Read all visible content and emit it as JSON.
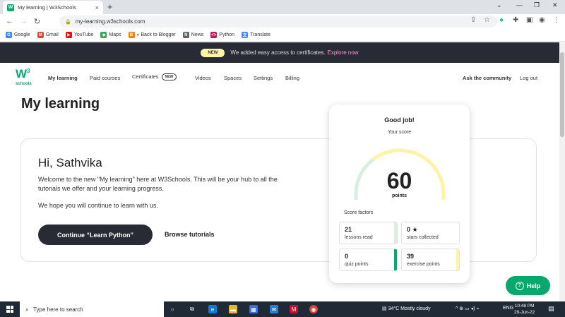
{
  "browser": {
    "tab_title": "My learning | W3Schools",
    "tab_favicon": "w3-favicon",
    "tab_close": "×",
    "new_tab": "+",
    "url": "my-learning.w3schools.com",
    "bookmarks": [
      {
        "label": "Google",
        "icon": "google-icon",
        "color": "#4285f4",
        "glyph": "G"
      },
      {
        "label": "Gmail",
        "icon": "gmail-icon",
        "color": "#ea4335",
        "glyph": "M"
      },
      {
        "label": "YouTube",
        "icon": "youtube-icon",
        "color": "#ff0000",
        "glyph": "▶"
      },
      {
        "label": "Maps",
        "icon": "maps-icon",
        "color": "#34a853",
        "glyph": "◆"
      },
      {
        "label": "« Back to Blogger",
        "icon": "blogger-icon",
        "color": "#f57d00",
        "glyph": "B"
      },
      {
        "label": "News",
        "icon": "news-icon",
        "color": "#5f6368",
        "glyph": "N"
      },
      {
        "label": "Python",
        "icon": "python-icon",
        "color": "#c2185b",
        "glyph": "<>"
      },
      {
        "label": "Translate",
        "icon": "translate-icon",
        "color": "#4285f4",
        "glyph": "文"
      }
    ]
  },
  "announcement": {
    "badge": "NEW",
    "text": "We added easy access to certificates.",
    "link": "Explore now"
  },
  "nav": {
    "logo_w": "W",
    "logo_sup": "3",
    "logo_text": "schools",
    "items": [
      "My learning",
      "Paid courses",
      "Certificates",
      "Videos",
      "Spaces",
      "Settings",
      "Billing"
    ],
    "certificates_badge": "NEW",
    "community": "Ask the community",
    "logout": "Log out"
  },
  "page": {
    "title": "My learning",
    "greeting": "Hi, Sathvika",
    "intro": "Welcome to the new \"My learning\" here at W3Schools. This will be your hub to all the tutorials we offer and your learning progress.",
    "hope": "We hope you will continue to learn with us.",
    "cta": "Continue “Learn Python”",
    "browse": "Browse tutorials"
  },
  "score": {
    "heading": "Good job!",
    "subheading": "Your score",
    "points": "60",
    "points_label": "points",
    "factors_label": "Score factors",
    "factors": [
      {
        "value": "21",
        "label": "lessons read",
        "color": "#d9eee1"
      },
      {
        "value": "0 ★",
        "label": "stars collected",
        "color": "#ffffff"
      },
      {
        "value": "0",
        "label": "quiz points",
        "color": "#04aa6d"
      },
      {
        "value": "39",
        "label": "exercise points",
        "color": "#fff4a3"
      }
    ],
    "gauge_fraction": 0.6,
    "gauge_colors": {
      "track": "#d9eee1",
      "fill": "#fff4a3"
    }
  },
  "help": "Help",
  "taskbar": {
    "search_placeholder": "Type here to search",
    "weather": "34°C  Mostly cloudy",
    "lang": "ENG",
    "time": "10:48 PM",
    "date": "29-Jun-22"
  },
  "colors": {
    "brand": "#04aa6d",
    "dark": "#282a35",
    "yellow": "#fff4a3"
  }
}
